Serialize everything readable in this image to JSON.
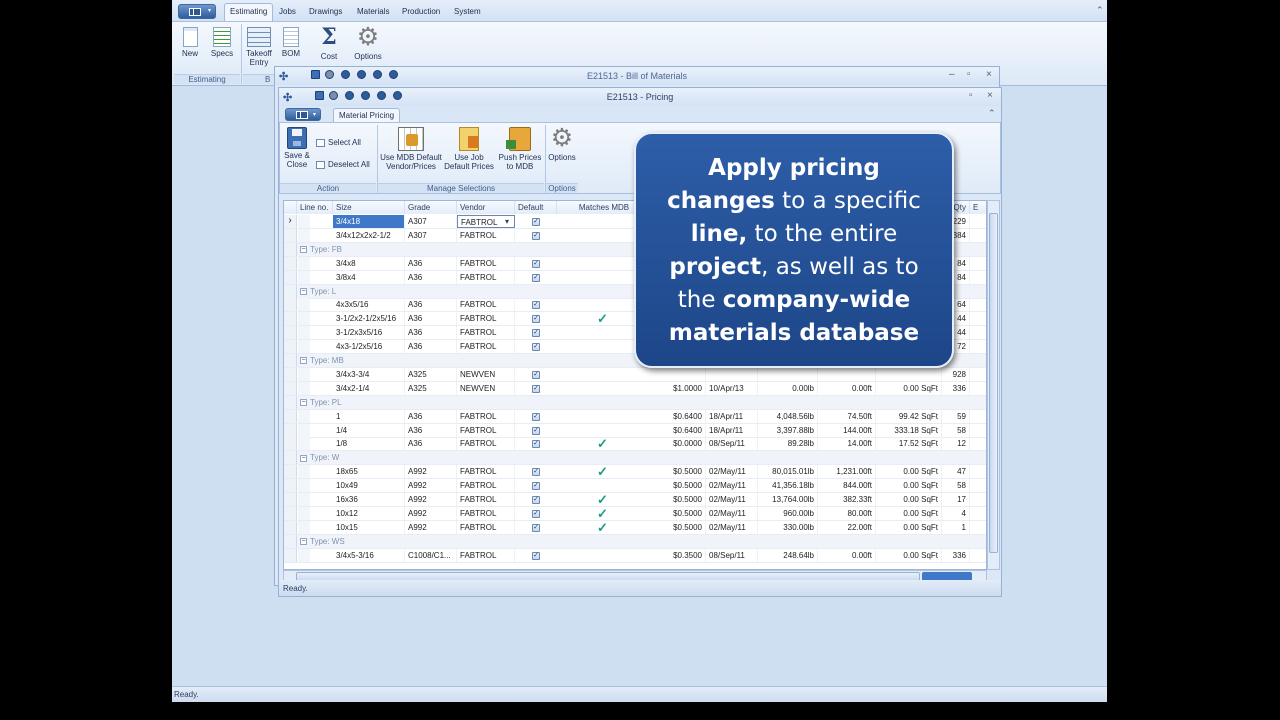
{
  "menubar": {
    "tabs": [
      "Estimating",
      "Jobs",
      "Drawings",
      "Materials",
      "Production",
      "System"
    ],
    "active_tab": "Estimating"
  },
  "ribbon": {
    "new": "New",
    "specs": "Specs",
    "takeoff_line1": "Takeoff",
    "takeoff_line2": "Entry",
    "bom": "BOM",
    "cost": "Cost",
    "options": "Options",
    "group_estimating": "Estimating",
    "group_b": "B"
  },
  "bom_window": {
    "title": "E21513 - Bill of Materials"
  },
  "pricing_window": {
    "title": "E21513 - Pricing",
    "tab": "Material Pricing",
    "buttons": {
      "save_line1": "Save &",
      "save_line2": "Close",
      "select_all": "Select All",
      "deselect_all": "Deselect All",
      "use_mdb_line1": "Use MDB Default",
      "use_mdb_line2": "Vendor/Prices",
      "use_job_line1": "Use Job",
      "use_job_line2": "Default Prices",
      "push_line1": "Push Prices",
      "push_line2": "to MDB",
      "options": "Options"
    },
    "groups": {
      "action": "Action",
      "manage": "Manage Selections",
      "options": "Options"
    },
    "status": "Ready."
  },
  "grid": {
    "headers": {
      "lineno": "Line no.",
      "size": "Size",
      "grade": "Grade",
      "vendor": "Vendor",
      "default": "Default",
      "matches": "Matches MDB",
      "qty": "Qty",
      "extra": "E"
    },
    "rows": [
      {
        "kind": "item",
        "size": "3/4x18",
        "grade": "A307",
        "vendor": "FABTROL",
        "def": true,
        "match": false,
        "price": "",
        "date": "",
        "weight": "",
        "length": "",
        "area": "",
        "qty": "229",
        "sel": true
      },
      {
        "kind": "item",
        "size": "3/4x12x2x2-1/2",
        "grade": "A307",
        "vendor": "FABTROL",
        "def": true,
        "match": false,
        "price": "",
        "date": "",
        "weight": "",
        "length": "",
        "area": "",
        "qty": "384"
      },
      {
        "kind": "group",
        "label": "Type: FB"
      },
      {
        "kind": "item",
        "size": "3/4x8",
        "grade": "A36",
        "vendor": "FABTROL",
        "def": true,
        "match": false,
        "price": "",
        "date": "",
        "weight": "",
        "length": "",
        "area": "",
        "qty": "84"
      },
      {
        "kind": "item",
        "size": "3/8x4",
        "grade": "A36",
        "vendor": "FABTROL",
        "def": true,
        "match": false,
        "price": "",
        "date": "",
        "weight": "",
        "length": "",
        "area": "",
        "qty": "84"
      },
      {
        "kind": "group",
        "label": "Type: L"
      },
      {
        "kind": "item",
        "size": "4x3x5/16",
        "grade": "A36",
        "vendor": "FABTROL",
        "def": true,
        "match": false,
        "price": "",
        "date": "",
        "weight": "",
        "length": "",
        "area": "",
        "qty": "64"
      },
      {
        "kind": "item",
        "size": "3-1/2x2-1/2x5/16",
        "grade": "A36",
        "vendor": "FABTROL",
        "def": true,
        "match": true,
        "price": "",
        "date": "",
        "weight": "",
        "length": "",
        "area": "",
        "qty": "44"
      },
      {
        "kind": "item",
        "size": "3-1/2x3x5/16",
        "grade": "A36",
        "vendor": "FABTROL",
        "def": true,
        "match": false,
        "price": "",
        "date": "",
        "weight": "",
        "length": "",
        "area": "",
        "qty": "44"
      },
      {
        "kind": "item",
        "size": "4x3-1/2x5/16",
        "grade": "A36",
        "vendor": "FABTROL",
        "def": true,
        "match": false,
        "price": "",
        "date": "",
        "weight": "",
        "length": "",
        "area": "",
        "qty": "72"
      },
      {
        "kind": "group",
        "label": "Type: MB"
      },
      {
        "kind": "item",
        "size": "3/4x3-3/4",
        "grade": "A325",
        "vendor": "NEWVEN",
        "def": true,
        "match": false,
        "price": "",
        "date": "",
        "weight": "",
        "length": "",
        "area": "",
        "qty": "928"
      },
      {
        "kind": "item",
        "size": "3/4x2-1/4",
        "grade": "A325",
        "vendor": "NEWVEN",
        "def": true,
        "match": false,
        "price": "$1.0000",
        "date": "10/Apr/13",
        "weight": "0.00lb",
        "length": "0.00ft",
        "area": "0.00 SqFt",
        "qty": "336"
      },
      {
        "kind": "group",
        "label": "Type: PL"
      },
      {
        "kind": "item",
        "size": "1",
        "grade": "A36",
        "vendor": "FABTROL",
        "def": true,
        "match": false,
        "price": "$0.6400",
        "date": "18/Apr/11",
        "weight": "4,048.56lb",
        "length": "74.50ft",
        "area": "99.42 SqFt",
        "qty": "59"
      },
      {
        "kind": "item",
        "size": "1/4",
        "grade": "A36",
        "vendor": "FABTROL",
        "def": true,
        "match": false,
        "price": "$0.6400",
        "date": "18/Apr/11",
        "weight": "3,397.88lb",
        "length": "144.00ft",
        "area": "333.18 SqFt",
        "qty": "58"
      },
      {
        "kind": "item",
        "size": "1/8",
        "grade": "A36",
        "vendor": "FABTROL",
        "def": true,
        "match": true,
        "price": "$0.0000",
        "date": "08/Sep/11",
        "weight": "89.28lb",
        "length": "14.00ft",
        "area": "17.52 SqFt",
        "qty": "12"
      },
      {
        "kind": "group",
        "label": "Type: W"
      },
      {
        "kind": "item",
        "size": "18x65",
        "grade": "A992",
        "vendor": "FABTROL",
        "def": true,
        "match": true,
        "price": "$0.5000",
        "date": "02/May/11",
        "weight": "80,015.01lb",
        "length": "1,231.00ft",
        "area": "0.00 SqFt",
        "qty": "47"
      },
      {
        "kind": "item",
        "size": "10x49",
        "grade": "A992",
        "vendor": "FABTROL",
        "def": true,
        "match": false,
        "price": "$0.5000",
        "date": "02/May/11",
        "weight": "41,356.18lb",
        "length": "844.00ft",
        "area": "0.00 SqFt",
        "qty": "58"
      },
      {
        "kind": "item",
        "size": "16x36",
        "grade": "A992",
        "vendor": "FABTROL",
        "def": true,
        "match": true,
        "price": "$0.5000",
        "date": "02/May/11",
        "weight": "13,764.00lb",
        "length": "382.33ft",
        "area": "0.00 SqFt",
        "qty": "17"
      },
      {
        "kind": "item",
        "size": "10x12",
        "grade": "A992",
        "vendor": "FABTROL",
        "def": true,
        "match": true,
        "price": "$0.5000",
        "date": "02/May/11",
        "weight": "960.00lb",
        "length": "80.00ft",
        "area": "0.00 SqFt",
        "qty": "4"
      },
      {
        "kind": "item",
        "size": "10x15",
        "grade": "A992",
        "vendor": "FABTROL",
        "def": true,
        "match": true,
        "price": "$0.5000",
        "date": "02/May/11",
        "weight": "330.00lb",
        "length": "22.00ft",
        "area": "0.00 SqFt",
        "qty": "1"
      },
      {
        "kind": "group",
        "label": "Type: WS"
      },
      {
        "kind": "item",
        "size": "3/4x5-3/16",
        "grade": "C1008/C1...",
        "vendor": "FABTROL",
        "def": true,
        "match": false,
        "price": "$0.3500",
        "date": "08/Sep/11",
        "weight": "248.64lb",
        "length": "0.00ft",
        "area": "0.00 SqFt",
        "qty": "336"
      }
    ]
  },
  "callout": {
    "t1": "Apply pricing",
    "t2a": "changes",
    "t2b": " to a specific",
    "t3a": "line,",
    "t3b": " to the entire",
    "t4a": "project",
    "t4b": ", as well as to",
    "t5a": "the ",
    "t5b": "company-wide",
    "t6": "materials database"
  },
  "status": "Ready.",
  "colors": {
    "callout_bg": "#1d4688",
    "accent": "#3f78c8",
    "match_tick": "#1f9a8a"
  }
}
